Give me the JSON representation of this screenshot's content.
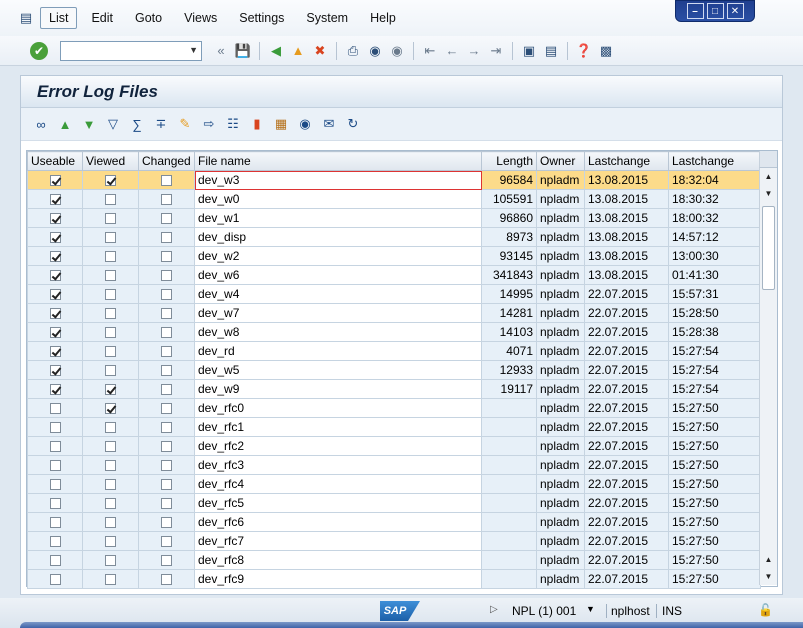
{
  "menubar": {
    "items": [
      "List",
      "Edit",
      "Goto",
      "Views",
      "Settings",
      "System",
      "Help"
    ],
    "active": "List"
  },
  "stdbar": {
    "command_value": "",
    "icons": [
      "enter-icon",
      "save-icon",
      "back-icon",
      "exit-icon",
      "cancel-icon",
      "print-icon",
      "find-icon",
      "find-next-icon",
      "first-page-icon",
      "previous-page-icon",
      "next-page-icon",
      "last-page-icon",
      "new-session-icon",
      "shortcut-icon",
      "help-icon",
      "layout-icon"
    ]
  },
  "panel": {
    "title": "Error Log Files"
  },
  "table": {
    "columns": [
      "Useable",
      "Viewed",
      "Changed",
      "File name",
      "Length",
      "Owner",
      "Lastchange",
      "Lastchange"
    ],
    "rows": [
      {
        "useable": true,
        "viewed": true,
        "changed": false,
        "name": "dev_w3",
        "length": "96584",
        "owner": "npladm",
        "date": "13.08.2015",
        "time": "18:32:04",
        "selected": true
      },
      {
        "useable": true,
        "viewed": false,
        "changed": false,
        "name": "dev_w0",
        "length": "105591",
        "owner": "npladm",
        "date": "13.08.2015",
        "time": "18:30:32"
      },
      {
        "useable": true,
        "viewed": false,
        "changed": false,
        "name": "dev_w1",
        "length": "96860",
        "owner": "npladm",
        "date": "13.08.2015",
        "time": "18:00:32"
      },
      {
        "useable": true,
        "viewed": false,
        "changed": false,
        "name": "dev_disp",
        "length": "8973",
        "owner": "npladm",
        "date": "13.08.2015",
        "time": "14:57:12"
      },
      {
        "useable": true,
        "viewed": false,
        "changed": false,
        "name": "dev_w2",
        "length": "93145",
        "owner": "npladm",
        "date": "13.08.2015",
        "time": "13:00:30"
      },
      {
        "useable": true,
        "viewed": false,
        "changed": false,
        "name": "dev_w6",
        "length": "341843",
        "owner": "npladm",
        "date": "13.08.2015",
        "time": "01:41:30"
      },
      {
        "useable": true,
        "viewed": false,
        "changed": false,
        "name": "dev_w4",
        "length": "14995",
        "owner": "npladm",
        "date": "22.07.2015",
        "time": "15:57:31"
      },
      {
        "useable": true,
        "viewed": false,
        "changed": false,
        "name": "dev_w7",
        "length": "14281",
        "owner": "npladm",
        "date": "22.07.2015",
        "time": "15:28:50"
      },
      {
        "useable": true,
        "viewed": false,
        "changed": false,
        "name": "dev_w8",
        "length": "14103",
        "owner": "npladm",
        "date": "22.07.2015",
        "time": "15:28:38"
      },
      {
        "useable": true,
        "viewed": false,
        "changed": false,
        "name": "dev_rd",
        "length": "4071",
        "owner": "npladm",
        "date": "22.07.2015",
        "time": "15:27:54"
      },
      {
        "useable": true,
        "viewed": false,
        "changed": false,
        "name": "dev_w5",
        "length": "12933",
        "owner": "npladm",
        "date": "22.07.2015",
        "time": "15:27:54"
      },
      {
        "useable": true,
        "viewed": true,
        "changed": false,
        "name": "dev_w9",
        "length": "19117",
        "owner": "npladm",
        "date": "22.07.2015",
        "time": "15:27:54"
      },
      {
        "useable": false,
        "viewed": true,
        "changed": false,
        "name": "dev_rfc0",
        "length": "",
        "owner": "npladm",
        "date": "22.07.2015",
        "time": "15:27:50"
      },
      {
        "useable": false,
        "viewed": false,
        "changed": false,
        "name": "dev_rfc1",
        "length": "",
        "owner": "npladm",
        "date": "22.07.2015",
        "time": "15:27:50"
      },
      {
        "useable": false,
        "viewed": false,
        "changed": false,
        "name": "dev_rfc2",
        "length": "",
        "owner": "npladm",
        "date": "22.07.2015",
        "time": "15:27:50"
      },
      {
        "useable": false,
        "viewed": false,
        "changed": false,
        "name": "dev_rfc3",
        "length": "",
        "owner": "npladm",
        "date": "22.07.2015",
        "time": "15:27:50"
      },
      {
        "useable": false,
        "viewed": false,
        "changed": false,
        "name": "dev_rfc4",
        "length": "",
        "owner": "npladm",
        "date": "22.07.2015",
        "time": "15:27:50"
      },
      {
        "useable": false,
        "viewed": false,
        "changed": false,
        "name": "dev_rfc5",
        "length": "",
        "owner": "npladm",
        "date": "22.07.2015",
        "time": "15:27:50"
      },
      {
        "useable": false,
        "viewed": false,
        "changed": false,
        "name": "dev_rfc6",
        "length": "",
        "owner": "npladm",
        "date": "22.07.2015",
        "time": "15:27:50"
      },
      {
        "useable": false,
        "viewed": false,
        "changed": false,
        "name": "dev_rfc7",
        "length": "",
        "owner": "npladm",
        "date": "22.07.2015",
        "time": "15:27:50"
      },
      {
        "useable": false,
        "viewed": false,
        "changed": false,
        "name": "dev_rfc8",
        "length": "",
        "owner": "npladm",
        "date": "22.07.2015",
        "time": "15:27:50"
      },
      {
        "useable": false,
        "viewed": false,
        "changed": false,
        "name": "dev_rfc9",
        "length": "",
        "owner": "npladm",
        "date": "22.07.2015",
        "time": "15:27:50"
      }
    ]
  },
  "statusbar": {
    "logo": "SAP",
    "system": "NPL (1) 001",
    "host": "nplhost",
    "mode": "INS"
  }
}
